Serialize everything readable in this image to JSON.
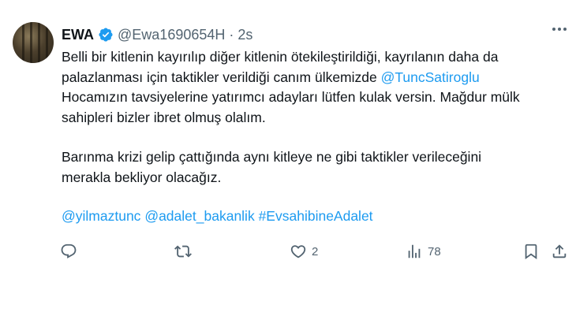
{
  "tweet": {
    "author_name": "EWA",
    "handle": "@Ewa1690654H",
    "separator": "·",
    "time": "2s",
    "text": {
      "line1": "Belli bir kitlenin kayırılıp diğer kitlenin ötekileştirildiği, kayrılanın daha da",
      "line2_prefix": "palazlanması için taktikler verildiği canım ülkemizde ",
      "mention_in_text": "@TuncSatiroglu",
      "line3": "Hocamızın tavsiyelerine yatırımcı adayları lütfen kulak versin. Mağdur mülk",
      "line4": "sahipleri bizler ibret olmuş olalım.",
      "line5": "Barınma krizi gelip çattığında aynı kitleye ne gibi taktikler verileceğini",
      "line6": "merakla bekliyor olacağız."
    },
    "tags": [
      "@yilmaztunc",
      "@adalet_bakanlik",
      "#EvsahibineAdalet"
    ],
    "actions": {
      "reply_count": "",
      "retweet_count": "",
      "like_count": "2",
      "views_count": "78"
    }
  },
  "colors": {
    "link": "#1d9bf0",
    "muted": "#536471",
    "text": "#0f1419"
  },
  "icons": [
    "more-icon",
    "verified-icon",
    "reply-icon",
    "retweet-icon",
    "like-icon",
    "views-icon",
    "bookmark-icon",
    "share-icon"
  ]
}
